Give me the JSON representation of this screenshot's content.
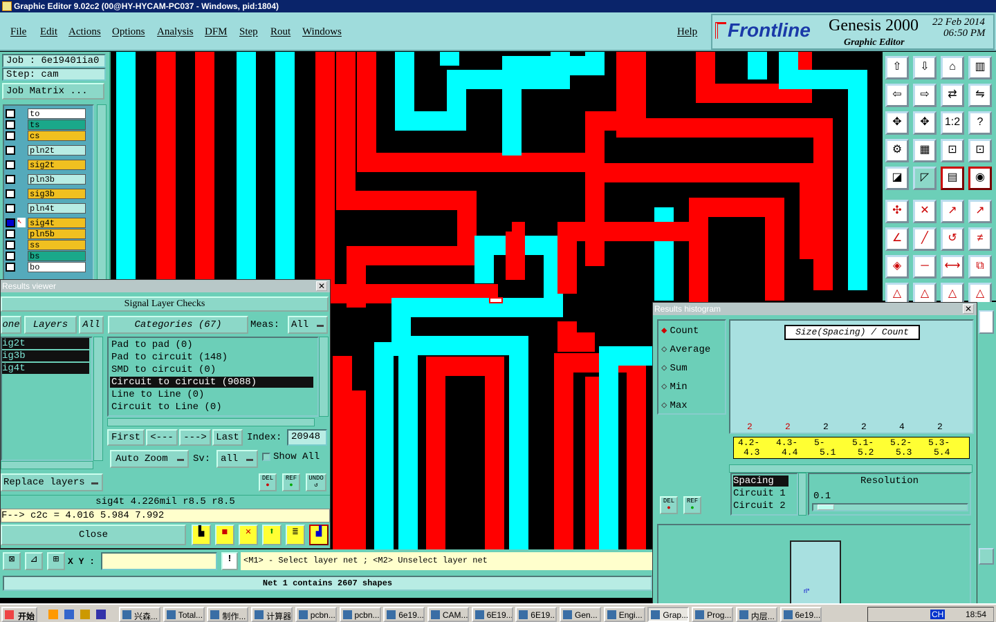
{
  "window": {
    "title": "Graphic Editor 9.02c2 (00@HY-HYCAM-PC037 - Windows, pid:1804)"
  },
  "menu": [
    "File",
    "Edit",
    "Actions",
    "Options",
    "Analysis",
    "DFM",
    "Step",
    "Rout",
    "Windows"
  ],
  "help": "Help",
  "logo": {
    "brand": "Frontline",
    "product": "Genesis 2000",
    "subtitle": "Graphic Editor",
    "date": "22 Feb 2014",
    "time": "06:50 PM"
  },
  "job": {
    "job": "Job : 6e19401ia0",
    "step": "Step: cam",
    "matrix_button": "Job Matrix ..."
  },
  "layers": [
    {
      "name": "to",
      "color": "#ffffff"
    },
    {
      "name": "ts",
      "color": "#1aa88a"
    },
    {
      "name": "cs",
      "color": "#f0c020"
    },
    {
      "name": "pln2t",
      "color": "#b8ece4"
    },
    {
      "name": "sig2t",
      "color": "#f0c020"
    },
    {
      "name": "pln3b",
      "color": "#b8ece4"
    },
    {
      "name": "sig3b",
      "color": "#f0c020"
    },
    {
      "name": "pln4t",
      "color": "#b8ece4"
    },
    {
      "name": "sig4t",
      "color": "#f0c020"
    },
    {
      "name": "pln5b",
      "color": "#f0c020"
    },
    {
      "name": "ss",
      "color": "#f0c020"
    },
    {
      "name": "bs",
      "color": "#1aa88a"
    },
    {
      "name": "bo",
      "color": "#ffffff"
    }
  ],
  "results_viewer": {
    "title": "Results viewer",
    "header": "Signal Layer Checks",
    "tab_none": "one",
    "tab_layers": "Layers",
    "tab_all": "All",
    "categories_label": "Categories (67)",
    "meas_label": "Meas:",
    "meas_value": "All",
    "layer_list": [
      "ig2t",
      "ig3b",
      "ig4t"
    ],
    "categories": [
      "Pad to pad (0)",
      "Pad to circuit (148)",
      "SMD to circuit (0)",
      "Circuit to circuit (9088)",
      "Line to Line (0)",
      "Circuit to Line (0)"
    ],
    "selected_category": 3,
    "nav": {
      "first": "First",
      "prev": "<---",
      "next": "--->",
      "last": "Last",
      "index_label": "Index:",
      "index_value": "20948"
    },
    "auto_zoom": "Auto Zoom",
    "sv_label": "Sv:",
    "sv_value": "all",
    "show_all": "Show All",
    "replace_layers": "Replace layers",
    "del": "DEL",
    "ref": "REF",
    "undo": "UNDO",
    "status1": "sig4t 4.226mil  r8.5  r8.5",
    "status2": "F--> c2c = 4.016 5.984 7.992",
    "close": "Close"
  },
  "histogram": {
    "title": "Results histogram",
    "options": [
      "Count",
      "Average",
      "Sum",
      "Min",
      "Max"
    ],
    "selected_option": 0,
    "chart_title": "Size(Spacing) / Count",
    "counts": [
      "2",
      "2",
      "2",
      "2",
      "4",
      "2"
    ],
    "bins": [
      [
        "4.2-",
        "4.3"
      ],
      [
        "4.3-",
        "4.4"
      ],
      [
        "5-",
        "5.1"
      ],
      [
        "5.1-",
        "5.2"
      ],
      [
        "5.2-",
        "5.3"
      ],
      [
        "5.3-",
        "5.4"
      ]
    ],
    "list": [
      "Spacing",
      "Circuit  1",
      "Circuit  2"
    ],
    "resolution_label": "Resolution",
    "resolution_value": "0.1",
    "del": "DEL",
    "ref": "REF",
    "preview_label": "rl*"
  },
  "prompt": {
    "xy_label": "X Y :",
    "message": "<M1> - Select layer net ; <M2> Unselect layer net",
    "status": "Net 1 contains 2607 shapes"
  },
  "taskbar": {
    "start": "开始",
    "items": [
      "兴森...",
      "Total...",
      "制作...",
      "计算器",
      "pcbn...",
      "pcbn...",
      "6e19...",
      "CAM...",
      "6E19...",
      "6E19...",
      "Gen...",
      "Engi...",
      "Grap...",
      "Prog...",
      "内层...",
      "6e19..."
    ],
    "clock": "18:54",
    "tray_lang": "CH"
  },
  "colors": {
    "red": "#ff0000",
    "cyan": "#00ffff",
    "panel": "#6ccfb8",
    "menu": "#9fdcdc",
    "highlight": "#ffff33"
  }
}
